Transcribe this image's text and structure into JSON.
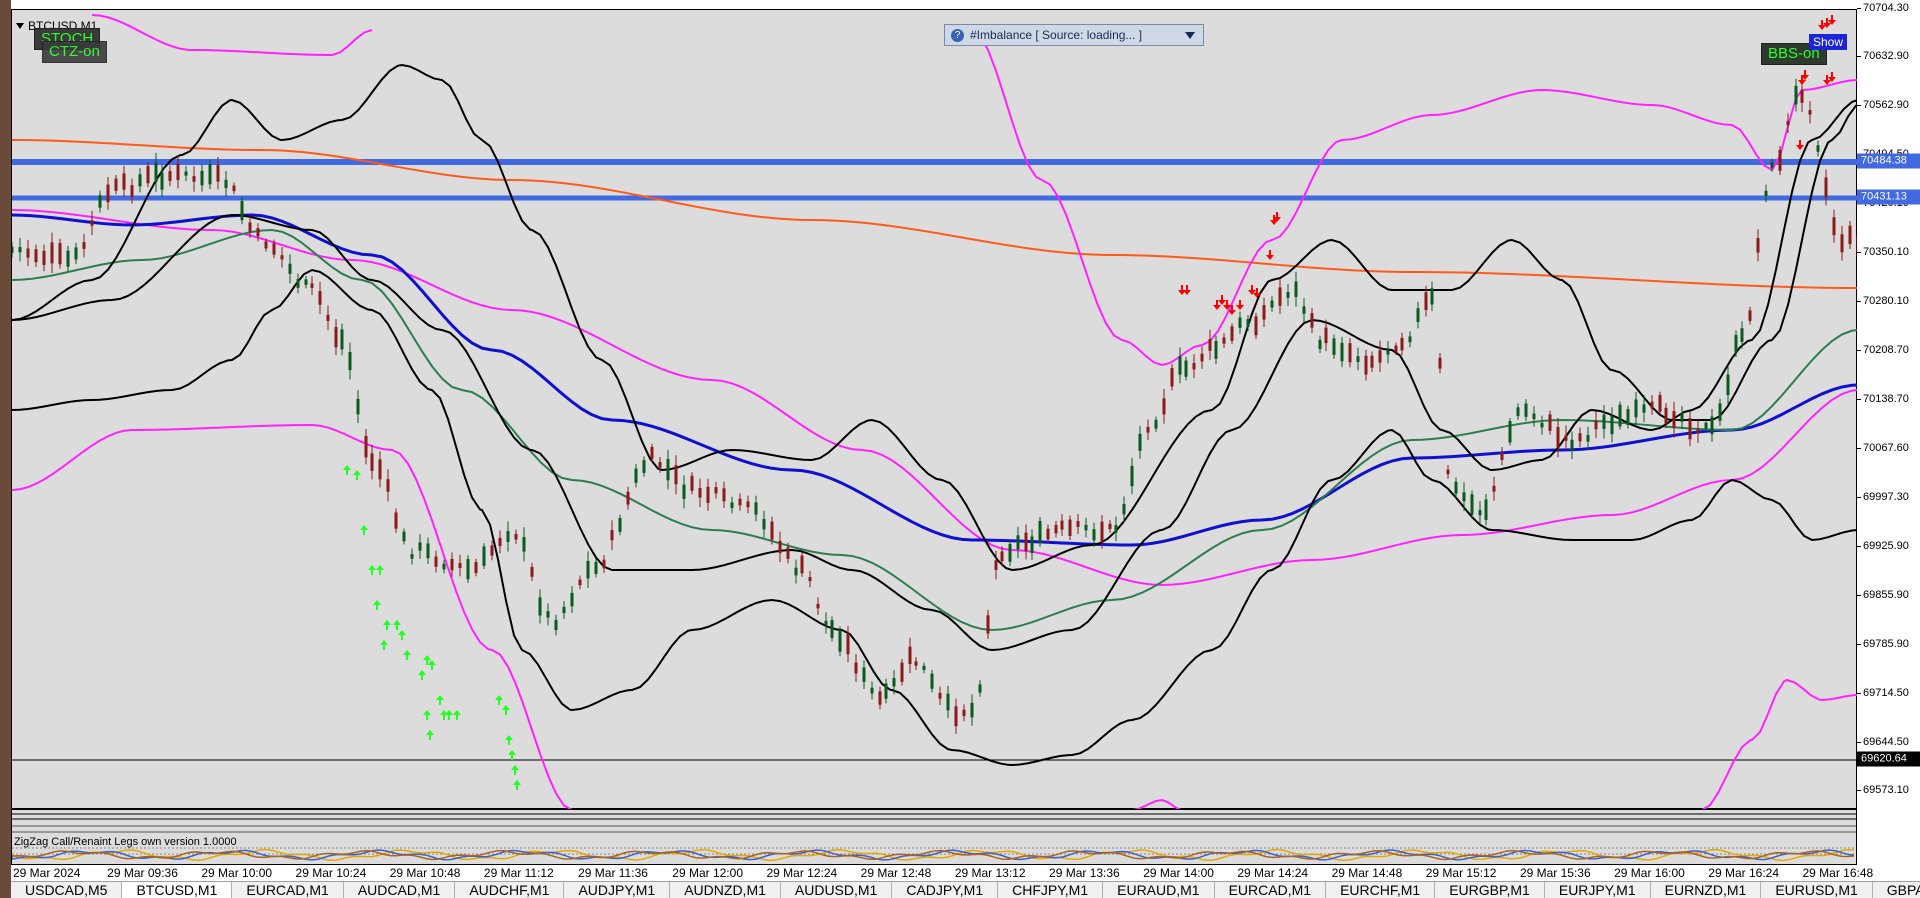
{
  "window": {
    "title": "BTCUSD,M1"
  },
  "buttons": {
    "stoch": "STOCH",
    "ctz": "CTZ-on",
    "bbs": "BBS-on",
    "show": "Show"
  },
  "imbalance_panel": {
    "info_glyph": "?",
    "label": "#Imbalance [ Source: loading... ]"
  },
  "price_axis": {
    "ticks": [
      "70704.30",
      "70632.90",
      "70562.90",
      "70494.50",
      "70420.10",
      "70350.10",
      "70280.10",
      "70208.70",
      "70138.70",
      "70067.60",
      "69997.30",
      "69925.90",
      "69855.90",
      "69785.90",
      "69714.50",
      "69644.50",
      "69573.10"
    ],
    "line_labels": [
      {
        "text": "70484.38",
        "color": "#4169e1"
      },
      {
        "text": "70431.13",
        "color": "#4169e1"
      },
      {
        "text": "69620.64",
        "color": "#000000"
      }
    ]
  },
  "indicator": {
    "label": "ZigZag Call/Renaint Legs own version 1.0000",
    "scale_top": "100",
    "scale_bottom": "0"
  },
  "time_axis": {
    "labels": [
      "29 Mar 2024",
      "29 Mar 09:36",
      "29 Mar 10:00",
      "29 Mar 10:24",
      "29 Mar 10:48",
      "29 Mar 11:12",
      "29 Mar 11:36",
      "29 Mar 12:00",
      "29 Mar 12:24",
      "29 Mar 12:48",
      "29 Mar 13:12",
      "29 Mar 13:36",
      "29 Mar 14:00",
      "29 Mar 14:24",
      "29 Mar 14:48",
      "29 Mar 15:12",
      "29 Mar 15:36",
      "29 Mar 16:00",
      "29 Mar 16:24",
      "29 Mar 16:48"
    ]
  },
  "tabs": [
    "USDCAD,M5",
    "BTCUSD,M1",
    "EURCAD,M1",
    "AUDCAD,M1",
    "AUDCHF,M1",
    "AUDJPY,M1",
    "AUDNZD,M1",
    "AUDUSD,M1",
    "CADJPY,M1",
    "CHFJPY,M1",
    "EURAUD,M1",
    "EURCAD,M1",
    "EURCHF,M1",
    "EURGBP,M1",
    "EURJPY,M1",
    "EURNZD,M1",
    "EURUSD,M1",
    "GBPA"
  ],
  "active_tab_index": 1,
  "colors": {
    "plot_bg": "#dcdcdc",
    "horizontal_line": "#4169e1",
    "ma_blue": "#1010d0",
    "ma_green": "#2e7d4f",
    "ma_orange": "#ff5a1a",
    "band_magenta": "#ff22ff",
    "band_black": "#000000",
    "candle_bull": "#0a5a1e",
    "candle_bear": "#8b1a1a",
    "arrow_up": "#22ff22",
    "arrow_down": "#ff0000"
  }
}
